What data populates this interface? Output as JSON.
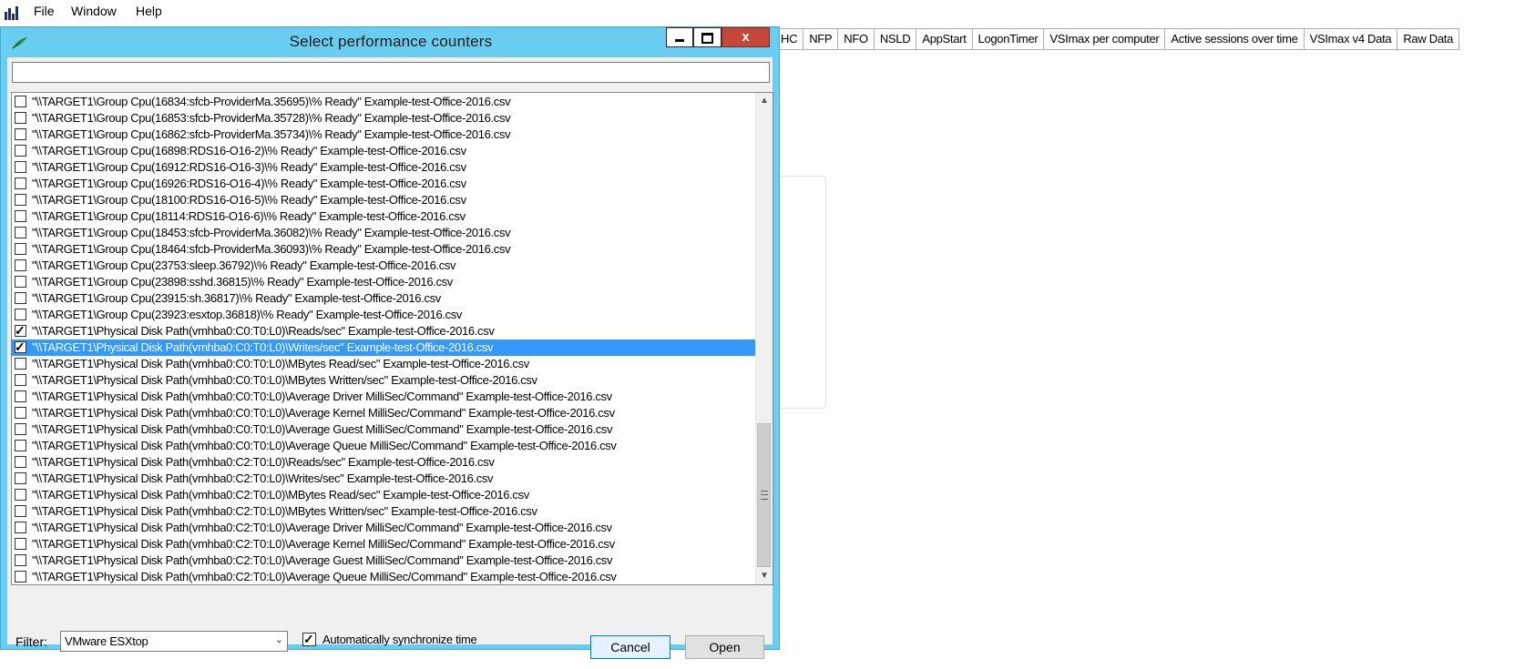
{
  "menubar": {
    "items": [
      "File",
      "Window",
      "Help"
    ]
  },
  "tabs": [
    "HC",
    "NFP",
    "NFO",
    "NSLD",
    "AppStart",
    "LogonTimer",
    "VSImax per computer",
    "Active sessions over time",
    "VSImax v4 Data",
    "Raw Data"
  ],
  "dialog": {
    "title": "Select performance counters",
    "search_value": "",
    "close_glyph": "x",
    "counters": [
      {
        "text": "\"\\\\TARGET1\\Group Cpu(16834:sfcb-ProviderMa.35695)\\% Ready\" Example-test-Office-2016.csv",
        "checked": false,
        "selected": false
      },
      {
        "text": "\"\\\\TARGET1\\Group Cpu(16853:sfcb-ProviderMa.35728)\\% Ready\" Example-test-Office-2016.csv",
        "checked": false,
        "selected": false
      },
      {
        "text": "\"\\\\TARGET1\\Group Cpu(16862:sfcb-ProviderMa.35734)\\% Ready\" Example-test-Office-2016.csv",
        "checked": false,
        "selected": false
      },
      {
        "text": "\"\\\\TARGET1\\Group Cpu(16898:RDS16-O16-2)\\% Ready\" Example-test-Office-2016.csv",
        "checked": false,
        "selected": false
      },
      {
        "text": "\"\\\\TARGET1\\Group Cpu(16912:RDS16-O16-3)\\% Ready\" Example-test-Office-2016.csv",
        "checked": false,
        "selected": false
      },
      {
        "text": "\"\\\\TARGET1\\Group Cpu(16926:RDS16-O16-4)\\% Ready\" Example-test-Office-2016.csv",
        "checked": false,
        "selected": false
      },
      {
        "text": "\"\\\\TARGET1\\Group Cpu(18100:RDS16-O16-5)\\% Ready\" Example-test-Office-2016.csv",
        "checked": false,
        "selected": false
      },
      {
        "text": "\"\\\\TARGET1\\Group Cpu(18114:RDS16-O16-6)\\% Ready\" Example-test-Office-2016.csv",
        "checked": false,
        "selected": false
      },
      {
        "text": "\"\\\\TARGET1\\Group Cpu(18453:sfcb-ProviderMa.36082)\\% Ready\" Example-test-Office-2016.csv",
        "checked": false,
        "selected": false
      },
      {
        "text": "\"\\\\TARGET1\\Group Cpu(18464:sfcb-ProviderMa.36093)\\% Ready\" Example-test-Office-2016.csv",
        "checked": false,
        "selected": false
      },
      {
        "text": "\"\\\\TARGET1\\Group Cpu(23753:sleep.36792)\\% Ready\" Example-test-Office-2016.csv",
        "checked": false,
        "selected": false
      },
      {
        "text": "\"\\\\TARGET1\\Group Cpu(23898:sshd.36815)\\% Ready\" Example-test-Office-2016.csv",
        "checked": false,
        "selected": false
      },
      {
        "text": "\"\\\\TARGET1\\Group Cpu(23915:sh.36817)\\% Ready\" Example-test-Office-2016.csv",
        "checked": false,
        "selected": false
      },
      {
        "text": "\"\\\\TARGET1\\Group Cpu(23923:esxtop.36818)\\% Ready\" Example-test-Office-2016.csv",
        "checked": false,
        "selected": false
      },
      {
        "text": "\"\\\\TARGET1\\Physical Disk Path(vmhba0:C0:T0:L0)\\Reads/sec\" Example-test-Office-2016.csv",
        "checked": true,
        "selected": false
      },
      {
        "text": "\"\\\\TARGET1\\Physical Disk Path(vmhba0:C0:T0:L0)\\Writes/sec\" Example-test-Office-2016.csv",
        "checked": true,
        "selected": true
      },
      {
        "text": "\"\\\\TARGET1\\Physical Disk Path(vmhba0:C0:T0:L0)\\MBytes Read/sec\" Example-test-Office-2016.csv",
        "checked": false,
        "selected": false
      },
      {
        "text": "\"\\\\TARGET1\\Physical Disk Path(vmhba0:C0:T0:L0)\\MBytes Written/sec\" Example-test-Office-2016.csv",
        "checked": false,
        "selected": false
      },
      {
        "text": "\"\\\\TARGET1\\Physical Disk Path(vmhba0:C0:T0:L0)\\Average Driver MilliSec/Command\" Example-test-Office-2016.csv",
        "checked": false,
        "selected": false
      },
      {
        "text": "\"\\\\TARGET1\\Physical Disk Path(vmhba0:C0:T0:L0)\\Average Kernel MilliSec/Command\" Example-test-Office-2016.csv",
        "checked": false,
        "selected": false
      },
      {
        "text": "\"\\\\TARGET1\\Physical Disk Path(vmhba0:C0:T0:L0)\\Average Guest MilliSec/Command\" Example-test-Office-2016.csv",
        "checked": false,
        "selected": false
      },
      {
        "text": "\"\\\\TARGET1\\Physical Disk Path(vmhba0:C0:T0:L0)\\Average Queue MilliSec/Command\" Example-test-Office-2016.csv",
        "checked": false,
        "selected": false
      },
      {
        "text": "\"\\\\TARGET1\\Physical Disk Path(vmhba0:C2:T0:L0)\\Reads/sec\" Example-test-Office-2016.csv",
        "checked": false,
        "selected": false
      },
      {
        "text": "\"\\\\TARGET1\\Physical Disk Path(vmhba0:C2:T0:L0)\\Writes/sec\" Example-test-Office-2016.csv",
        "checked": false,
        "selected": false
      },
      {
        "text": "\"\\\\TARGET1\\Physical Disk Path(vmhba0:C2:T0:L0)\\MBytes Read/sec\" Example-test-Office-2016.csv",
        "checked": false,
        "selected": false
      },
      {
        "text": "\"\\\\TARGET1\\Physical Disk Path(vmhba0:C2:T0:L0)\\MBytes Written/sec\" Example-test-Office-2016.csv",
        "checked": false,
        "selected": false
      },
      {
        "text": "\"\\\\TARGET1\\Physical Disk Path(vmhba0:C2:T0:L0)\\Average Driver MilliSec/Command\" Example-test-Office-2016.csv",
        "checked": false,
        "selected": false
      },
      {
        "text": "\"\\\\TARGET1\\Physical Disk Path(vmhba0:C2:T0:L0)\\Average Kernel MilliSec/Command\" Example-test-Office-2016.csv",
        "checked": false,
        "selected": false
      },
      {
        "text": "\"\\\\TARGET1\\Physical Disk Path(vmhba0:C2:T0:L0)\\Average Guest MilliSec/Command\" Example-test-Office-2016.csv",
        "checked": false,
        "selected": false
      },
      {
        "text": "\"\\\\TARGET1\\Physical Disk Path(vmhba0:C2:T0:L0)\\Average Queue MilliSec/Command\" Example-test-Office-2016.csv",
        "checked": false,
        "selected": false
      }
    ],
    "filter_label": "Filter:",
    "filter_value": "VMware ESXtop",
    "sync_label": "Automatically synchronize time",
    "sync_checked": true,
    "cancel_label": "Cancel",
    "open_label": "Open"
  },
  "colors": {
    "title_bar": "#69cdf0",
    "close_button": "#c7463a",
    "selection": "#3399ff",
    "default_button_border": "#0078d7"
  },
  "icons": {
    "app": "bar-chart-icon",
    "dialog": "leaf-icon"
  }
}
